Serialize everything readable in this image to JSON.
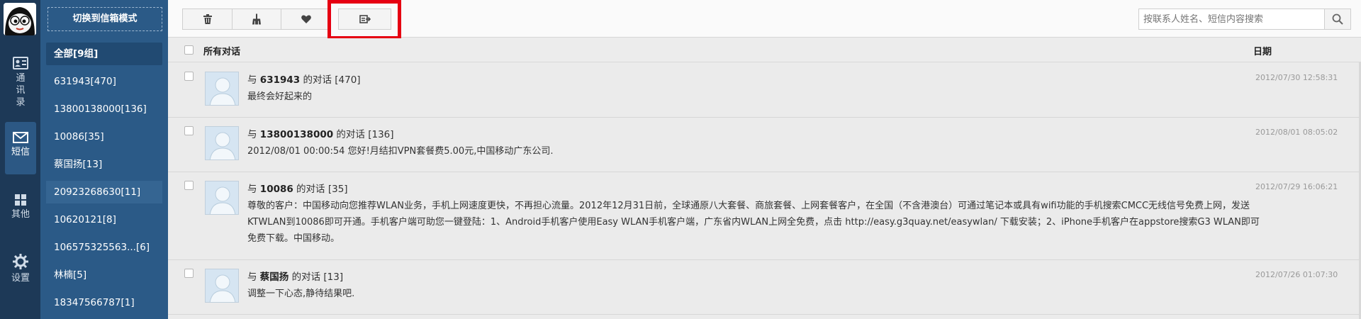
{
  "rail": {
    "items": [
      {
        "label": "通讯录",
        "icon": "contacts-icon"
      },
      {
        "label": "短信",
        "icon": "envelope-icon"
      },
      {
        "label": "其他",
        "icon": "grid-icon"
      },
      {
        "label": "设置",
        "icon": "gear-icon"
      }
    ],
    "active_index": 1
  },
  "groups": {
    "mode_button": "切换到信箱模式",
    "items": [
      "全部[9组]",
      "631943[470]",
      "13800138000[136]",
      "10086[35]",
      "蔡国扬[13]",
      "20923268630[11]",
      "10620121[8]",
      "106575325563...[6]",
      "林楠[5]",
      "18347566787[1]"
    ],
    "active_index": 0,
    "hover_index": 5
  },
  "toolbar": {
    "buttons": [
      "trash-icon",
      "broom-icon",
      "heart-icon",
      "export-icon"
    ],
    "highlighted_button": "export-icon",
    "highlight_color": "#e60012",
    "search_placeholder": "按联系人姓名、短信内容搜索",
    "search_icon": "search-icon"
  },
  "list": {
    "header_title": "所有对话",
    "header_date": "日期",
    "rows": [
      {
        "prefix": "与 ",
        "name": "631943",
        "suffix": " 的对话 [470]",
        "body": "最终会好起来的",
        "date": "2012/07/30 12:58:31"
      },
      {
        "prefix": "与 ",
        "name": "13800138000",
        "suffix": " 的对话 [136]",
        "body": "2012/08/01 00:00:54 您好!月结扣VPN套餐费5.00元,中国移动广东公司.",
        "date": "2012/08/01 08:05:02"
      },
      {
        "prefix": "与 ",
        "name": "10086",
        "suffix": " 的对话 [35]",
        "body": "尊敬的客户：中国移动向您推荐WLAN业务，手机上网速度更快，不再担心流量。2012年12月31日前，全球通原八大套餐、商旅套餐、上网套餐客户，在全国（不含港澳台）可通过笔记本或具有wifi功能的手机搜索CMCC无线信号免费上网，发送KTWLAN到10086即可开通。手机客户端可助您一键登陆：1、Android手机客户使用Easy WLAN手机客户端，广东省内WLAN上网全免费，点击 http://easy.g3quay.net/easywlan/ 下载安装；2、iPhone手机客户在appstore搜索G3 WLAN即可免费下载。中国移动。",
        "date": "2012/07/29 16:06:21"
      },
      {
        "prefix": "与 ",
        "name": "蔡国扬",
        "suffix": " 的对话 [13]",
        "body": "调整一下心态,静待结果吧.",
        "date": "2012/07/26 01:07:30"
      }
    ]
  },
  "colors": {
    "rail_bg": "#1d3957",
    "sidebar_bg": "#2b5a87",
    "main_bg": "#ebebeb"
  }
}
